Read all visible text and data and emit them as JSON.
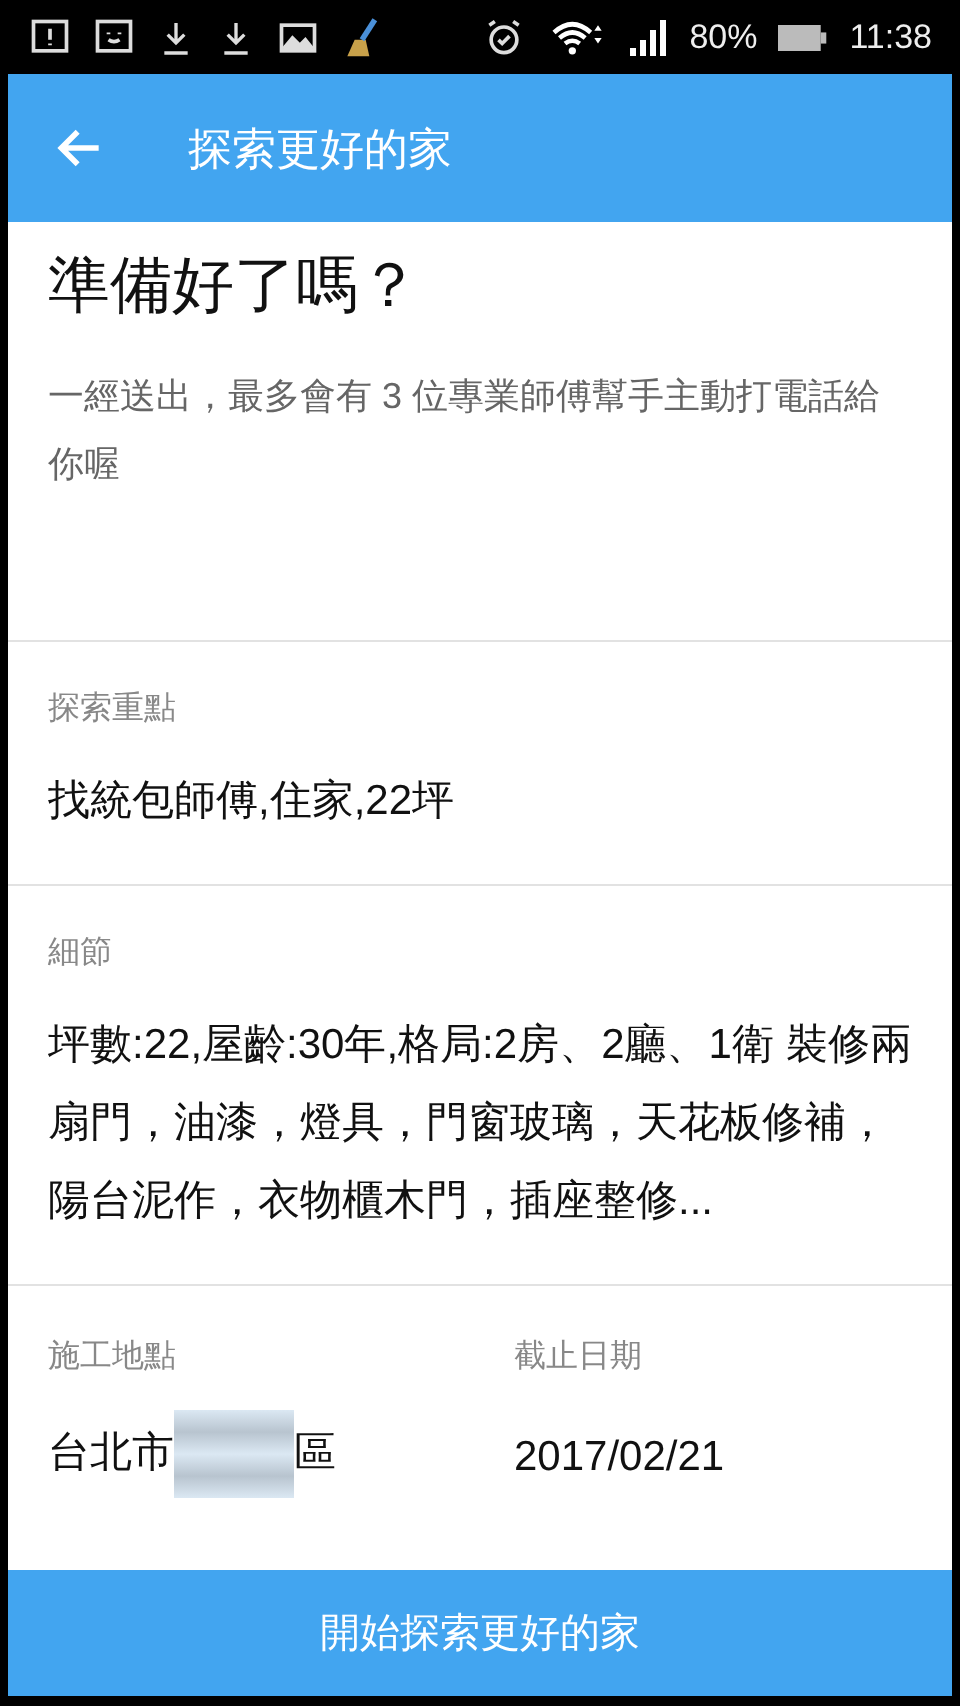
{
  "status_bar": {
    "battery": "80%",
    "time": "11:38"
  },
  "app_bar": {
    "title": "探索更好的家"
  },
  "intro": {
    "heading": "準備好了嗎？",
    "text": "一經送出，最多會有 3 位專業師傅幫手主動打電話給你喔"
  },
  "sections": [
    {
      "label": "探索重點",
      "value": "找統包師傅,住家,22坪"
    },
    {
      "label": "細節",
      "value": "坪數:22,屋齡:30年,格局:2房、2廳、1衛 裝修兩扇門，油漆，燈具，門窗玻璃，天花板修補，陽台泥作，衣物櫃木門，插座整修..."
    }
  ],
  "location": {
    "label": "施工地點",
    "value_start": "台北市",
    "value_end": "區"
  },
  "deadline": {
    "label": "截止日期",
    "value": "2017/02/21"
  },
  "submit_button": {
    "label": "開始探索更好的家"
  }
}
